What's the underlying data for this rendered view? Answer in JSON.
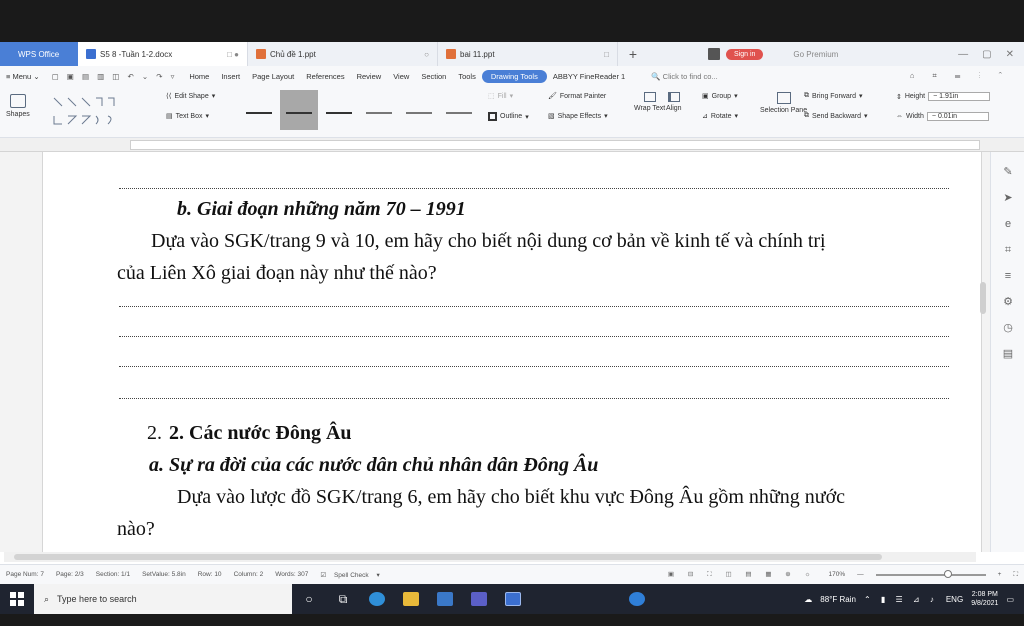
{
  "tabbar": {
    "app_tab": "WPS Office",
    "tabs": [
      {
        "label": "S5 8 -Tuần 1-2.docx",
        "active": true
      },
      {
        "label": "Chủ đề 1.ppt",
        "active": false
      },
      {
        "label": "bai 11.ppt",
        "active": false
      }
    ],
    "new_tab": "+",
    "sign_in": "Sign in",
    "premium": "Go Premium"
  },
  "menu": {
    "menu_label": "Menu",
    "items": [
      "Home",
      "Insert",
      "Page Layout",
      "References",
      "Review",
      "View",
      "Section",
      "Tools"
    ],
    "active_item": "Drawing Tools",
    "abbyy": "ABBYY FineReader 1",
    "search_placeholder": "Click to find co..."
  },
  "ribbon": {
    "shapes": "Shapes",
    "edit_shape": "Edit Shape",
    "text_box": "Text Box",
    "fill": "Fill",
    "outline": "Outline",
    "format_painter": "Format Painter",
    "shape_effects": "Shape Effects",
    "wrap_text": "Wrap Text",
    "align": "Align",
    "group": "Group",
    "rotate": "Rotate",
    "selection_pane": "Selection Pane",
    "bring_forward": "Bring Forward",
    "send_backward": "Send Backward",
    "height_label": "Height",
    "height_value": "1.91in",
    "width_label": "Width",
    "width_value": "0.01in"
  },
  "document": {
    "heading_b": "b. Giai đoạn những năm 70 – 1991",
    "para1_line1": "Dựa vào SGK/trang 9 và 10, em hãy cho biết nội dung cơ bản về kinh tế và chính trị",
    "para1_line2": "của Liên Xô giai đoạn này như thế nào?",
    "section2_prefix": "2.",
    "section2": "2. Các nước Đông Âu",
    "heading_a": "a. Sự ra đời của các nước dân chủ nhân dân Đông Âu",
    "para2_line1": "Dựa vào lược đồ SGK/trang 6, em hãy cho biết khu vực Đông Âu gồm những nước",
    "para2_line2": "nào?"
  },
  "status": {
    "page_num": "Page Num: 7",
    "page": "Page: 2/3",
    "section": "Section: 1/1",
    "set_value": "SetValue: 5.8in",
    "row": "Row: 10",
    "column": "Column: 2",
    "words": "Words: 307",
    "spell_check": "Spell Check",
    "zoom": "170%"
  },
  "taskbar": {
    "search_placeholder": "Type here to search",
    "weather": "88°F Rain",
    "lang": "ENG",
    "time": "2:08 PM",
    "date": "9/8/2021"
  },
  "colors": {
    "accent": "#4a7fd6",
    "sign_in": "#e0524e",
    "taskbar": "#1f2430"
  }
}
